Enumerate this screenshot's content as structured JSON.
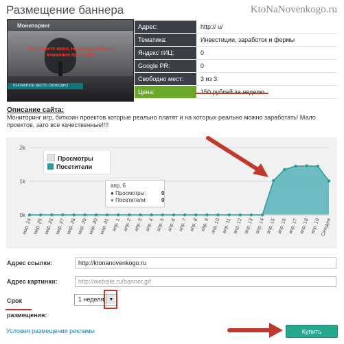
{
  "header": {
    "title": "Размещение баннера"
  },
  "watermark": {
    "text": "KtoNaNovenkogo.ru"
  },
  "banner": {
    "site_name": "Мониторинг",
    "headline": "На проекте мало, но все достойные внимания проекты!!!",
    "bar_text": "РЕКЛАМНОЕ МЕСТО СВОБОДНО"
  },
  "site_info": [
    {
      "label": "Адрес:",
      "value": "http://                                u/"
    },
    {
      "label": "Тематика:",
      "value": "Инвестиции, заработок и фермы"
    },
    {
      "label": "Яндекс тИЦ:",
      "value": "0"
    },
    {
      "label": "Google PR:",
      "value": "0"
    },
    {
      "label": "Свободно мест:",
      "value": "3 из 3"
    },
    {
      "label": "Цена:",
      "value": "150 рублей за неделю"
    }
  ],
  "description": {
    "title": "Описание сайта:",
    "text": "Мониторинг игр, биткоин проектов которые реально платят и на которых реально можно заработать! Мало проектов, зато все качественные!!!!"
  },
  "chart_data": {
    "type": "area",
    "x": [
      "мар. 24",
      "мар. 25",
      "мар. 26",
      "мар. 27",
      "мар. 28",
      "мар. 29",
      "мар. 30",
      "мар. 31",
      "апр. 1",
      "апр. 2",
      "апр. 3",
      "апр. 4",
      "апр. 5",
      "апр. 6",
      "апр. 7",
      "апр. 8",
      "апр. 9",
      "апр. 10",
      "апр. 11",
      "апр. 12",
      "апр. 13",
      "апр. 14",
      "апр. 15",
      "апр. 16",
      "апр. 17",
      "апр. 18",
      "апр. 19",
      "Сегодня"
    ],
    "series": [
      {
        "name": "Просмотры",
        "values": [
          0,
          0,
          0,
          0,
          0,
          0,
          0,
          0,
          0,
          0,
          0,
          0,
          0,
          0,
          0,
          0,
          0,
          0,
          0,
          0,
          0,
          0,
          0,
          0,
          0,
          0,
          0,
          0
        ]
      },
      {
        "name": "Посетители",
        "values": [
          0,
          0,
          0,
          0,
          0,
          0,
          0,
          0,
          0,
          0,
          0,
          0,
          0,
          0,
          0,
          0,
          0,
          0,
          0,
          0,
          0,
          0,
          1020,
          1350,
          1450,
          1460,
          1450,
          1010
        ]
      }
    ],
    "y_ticks": [
      "0k",
      "1k",
      "2k"
    ],
    "ylim": [
      0,
      2000
    ],
    "legend_position": "top-left",
    "grid": true,
    "tooltip": {
      "title": "апр. 6",
      "rows": [
        {
          "label": "Просмотры:",
          "value": "0"
        },
        {
          "label": "Посетители:",
          "value": "0"
        }
      ]
    },
    "colors": {
      "views": "#e0e0e0",
      "visitors": "#2a9aa0",
      "visitors_fill": "#56b3b8"
    }
  },
  "form": {
    "link_label": "Адрес ссылки:",
    "link_value": "http://ktonanovenkogo.ru",
    "image_label": "Адрес картинки:",
    "image_placeholder": "http://website.ru/banner.gif",
    "term_label_1": "Срок",
    "term_label_2": "размещения:",
    "term_value": "1 неделя",
    "term_arrow": "▼"
  },
  "footer": {
    "terms_link": "Условия размещения рекламы",
    "buy_label": "Купить"
  },
  "colors": {
    "accent": "#25a88e",
    "price_label": "#6aa82a",
    "annotation": "#c0392b"
  }
}
